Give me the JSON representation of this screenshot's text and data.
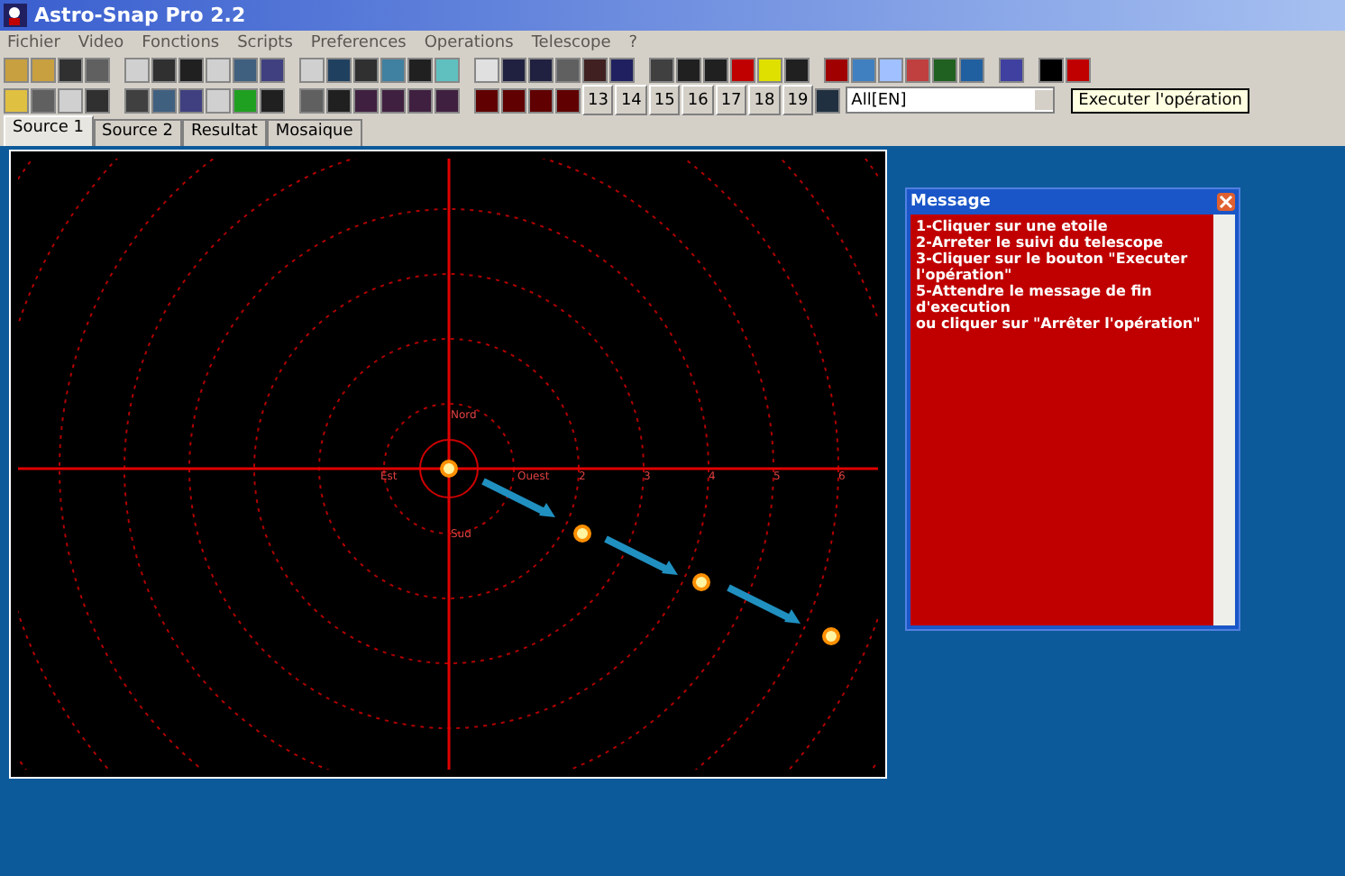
{
  "window": {
    "title": "Astro-Snap Pro 2.2"
  },
  "menu": [
    "Fichier",
    "Video",
    "Fonctions",
    "Scripts",
    "Preferences",
    "Operations",
    "Telescope",
    "?"
  ],
  "toolbar": {
    "number_buttons": [
      "13",
      "14",
      "15",
      "16",
      "17",
      "18",
      "19"
    ],
    "combo": {
      "value": "All[EN]"
    },
    "tooltip": "Executer l'opération"
  },
  "tabs": [
    {
      "label": "Source 1",
      "selected": true
    },
    {
      "label": "Source 2",
      "selected": false
    },
    {
      "label": "Resultat",
      "selected": false
    },
    {
      "label": "Mosaique",
      "selected": false
    }
  ],
  "chart_view": {
    "labels": {
      "north": "Nord",
      "south": "Sud",
      "east": "Est",
      "west": "Ouest"
    },
    "ticks": [
      "2",
      "3",
      "4",
      "5",
      "6"
    ]
  },
  "message": {
    "title": "Message",
    "lines": [
      "1-Cliquer sur une etoile",
      "2-Arreter le suivi du telescope",
      "3-Cliquer sur le bouton \"Executer l'opération\"",
      "5-Attendre le message de fin d'execution",
      "ou cliquer sur \"Arrêter l'opération\""
    ]
  }
}
